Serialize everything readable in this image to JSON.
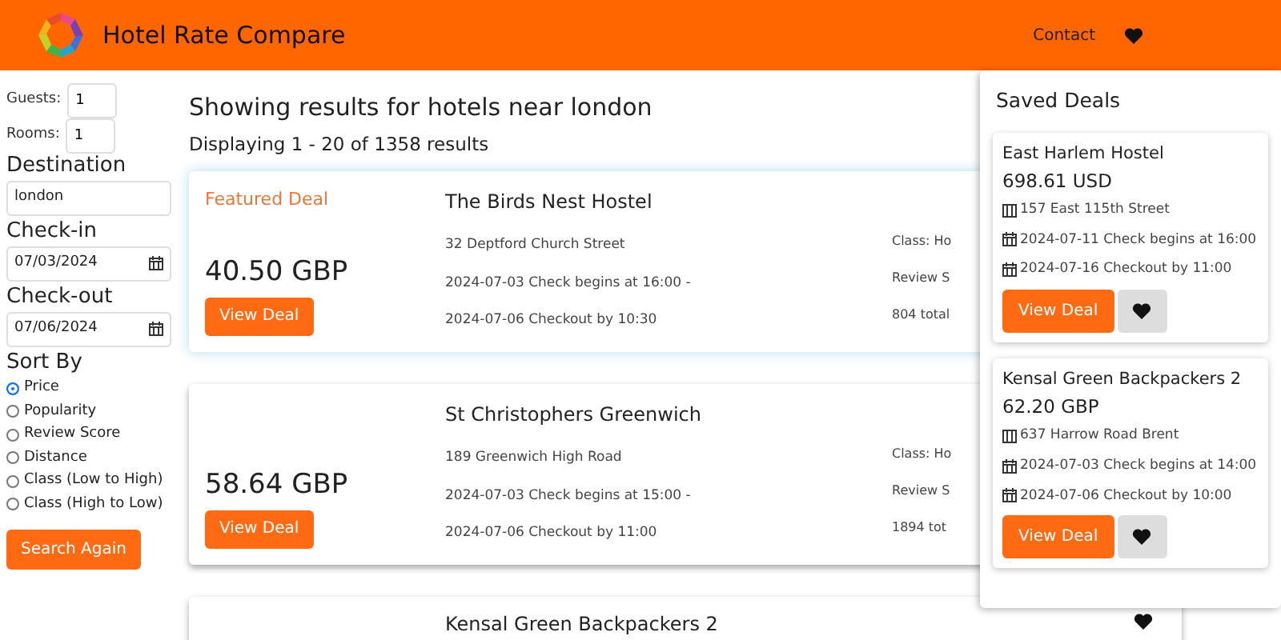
{
  "navbar": {
    "brand": "Hotel Rate Compare",
    "links": [
      "Contact"
    ]
  },
  "search_form": {
    "guests_label": "Guests:",
    "guests": "1",
    "rooms_label": "Rooms:",
    "rooms": "1",
    "destination_label": "Destination",
    "destination": "london",
    "checkin_label": "Check-in",
    "checkin": "07/03/2024",
    "checkout_label": "Check-out",
    "checkout": "07/06/2024",
    "sort_label": "Sort By",
    "sort_options": [
      {
        "label": "Price",
        "selected": true
      },
      {
        "label": "Popularity",
        "selected": false
      },
      {
        "label": "Review Score",
        "selected": false
      },
      {
        "label": "Distance",
        "selected": false
      },
      {
        "label": "Class (Low to High)",
        "selected": false
      },
      {
        "label": "Class (High to Low)",
        "selected": false
      }
    ],
    "button": "Search Again"
  },
  "results": {
    "heading": "Showing results for hotels near london",
    "summary": "Displaying 1 - 20 of 1358 results",
    "items": [
      {
        "featured": true,
        "featured_label": "Featured Deal",
        "name": "The Birds Nest Hostel",
        "address": "32 Deptford Church Street",
        "checkin": "2024-07-03 Check begins at 16:00 -",
        "checkout": "2024-07-06 Checkout by 10:30",
        "price": "40.50 GBP",
        "button": "View Deal",
        "class": "Class: Ho",
        "review": "Review S",
        "total": "804 total"
      },
      {
        "featured": false,
        "name": "St Christophers Greenwich",
        "address": "189 Greenwich High Road",
        "checkin": "2024-07-03 Check begins at 15:00 -",
        "checkout": "2024-07-06 Checkout by 11:00",
        "price": "58.64 GBP",
        "button": "View Deal",
        "class": "Class: Ho",
        "review": "Review S",
        "total": "1894 tot"
      },
      {
        "featured": false,
        "name": "Kensal Green Backpackers 2"
      }
    ]
  },
  "saved_deals": {
    "title": "Saved Deals",
    "items": [
      {
        "name": "East Harlem Hostel",
        "price": "698.61 USD",
        "address": "157 East 115th Street",
        "checkin": "2024-07-11 Check begins at 16:00",
        "checkout": "2024-07-16 Checkout by 11:00",
        "button": "View Deal"
      },
      {
        "name": "Kensal Green Backpackers 2",
        "price": "62.20 GBP",
        "address": "637 Harrow Road Brent",
        "checkin": "2024-07-03 Check begins at 14:00",
        "checkout": "2024-07-06 Checkout by 10:00",
        "button": "View Deal"
      }
    ]
  }
}
